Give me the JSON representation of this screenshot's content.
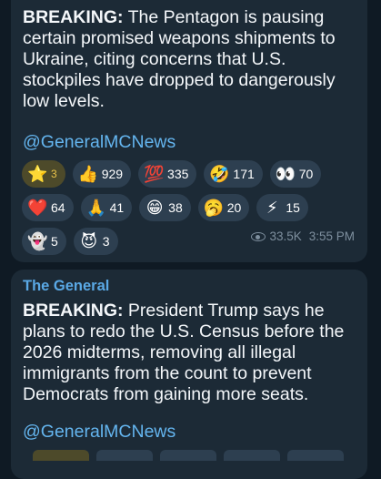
{
  "messages": [
    {
      "headline_bold": "BREAKING:",
      "headline_text": " The Pentagon is pausing certain promised weapons shipments to Ukraine, citing concerns that U.S. stockpiles have dropped to dangerously low levels.",
      "link": "@GeneralMCNews",
      "reactions": [
        [
          {
            "icon": "star-icon",
            "emoji": "⭐",
            "count": "3",
            "active": true
          },
          {
            "icon": "thumbs-up-icon",
            "emoji": "👍",
            "count": "929"
          },
          {
            "icon": "hundred-icon",
            "emoji": "💯",
            "count": "335"
          },
          {
            "icon": "rofl-icon",
            "emoji": "🤣",
            "count": "171"
          },
          {
            "icon": "eyes-icon",
            "emoji": "👀",
            "count": "70"
          }
        ],
        [
          {
            "icon": "heart-icon",
            "emoji": "❤️",
            "count": "64"
          },
          {
            "icon": "pray-icon",
            "emoji": "🙏",
            "count": "41"
          },
          {
            "icon": "grin-icon",
            "emoji": "😁",
            "count": "38"
          },
          {
            "icon": "yawn-icon",
            "emoji": "🥱",
            "count": "20"
          },
          {
            "icon": "lightning-icon",
            "emoji": "⚡",
            "count": "15"
          }
        ],
        [
          {
            "icon": "ghost-icon",
            "emoji": "👻",
            "count": "5"
          },
          {
            "icon": "devil-icon",
            "emoji": "😈",
            "count": "3"
          }
        ]
      ],
      "views": "33.5K",
      "time": "3:55 PM"
    },
    {
      "sender": "The General",
      "headline_bold": "BREAKING:",
      "headline_text": " President Trump says he plans to redo the U.S. Census before the 2026 midterms, removing all illegal immigrants from the count to prevent Democrats from gaining more seats.",
      "link": "@GeneralMCNews"
    }
  ]
}
